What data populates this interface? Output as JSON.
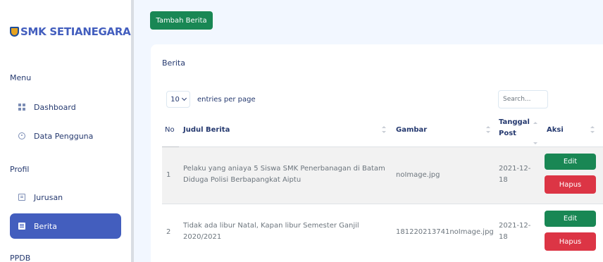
{
  "sidebar": {
    "brand": "SMK SETIANEGARA",
    "sections": {
      "menu": "Menu",
      "profil": "Profil",
      "ppdb": "PPDB"
    },
    "items": [
      {
        "label": "Dashboard",
        "icon": "grid-icon"
      },
      {
        "label": "Data Pengguna",
        "icon": "user-circle-icon"
      },
      {
        "label": "Jurusan",
        "icon": "list-icon"
      },
      {
        "label": "Berita",
        "icon": "newspaper-icon",
        "active": true
      }
    ]
  },
  "toolbar": {
    "add_label": "Tambah Berita"
  },
  "card": {
    "title": "Berita",
    "entries_value": "10",
    "entries_label": "entries per page",
    "search_placeholder": "Search..."
  },
  "table": {
    "headers": {
      "no": "No",
      "judul": "Judul Berita",
      "gambar": "Gambar",
      "tanggal": "Tanggal Post",
      "aksi": "Aksi"
    },
    "rows": [
      {
        "no": "1",
        "judul": "Pelaku yang aniaya 5 Siswa SMK Penerbanagan di Batam Diduga Polisi Berbapangkat Aiptu",
        "gambar": "noImage.jpg",
        "tanggal": "2021-12-18",
        "edit": "Edit",
        "hapus": "Hapus"
      },
      {
        "no": "2",
        "judul": "Tidak ada libur Natal, Kapan libur Semester Ganjil 2020/2021",
        "gambar": "181220213741noImage.jpg",
        "tanggal": "2021-12-18",
        "edit": "Edit",
        "hapus": "Hapus"
      }
    ]
  },
  "colors": {
    "primary": "#435ebe",
    "success": "#198754",
    "danger": "#dc3545",
    "background": "#f2f7ff"
  }
}
